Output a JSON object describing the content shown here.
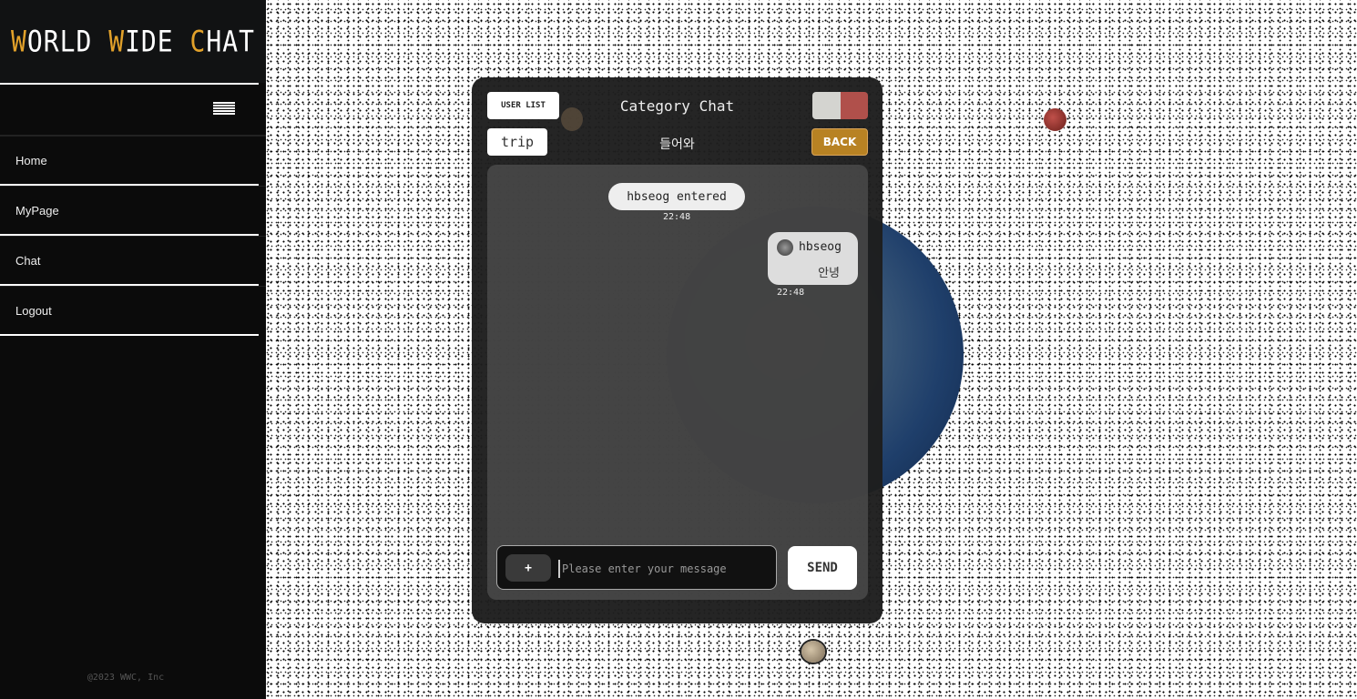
{
  "sidebar": {
    "logo": {
      "w1a": "W",
      "w1b": "ORLD ",
      "w2a": "W",
      "w2b": "IDE ",
      "w3a": "C",
      "w3b": "HAT"
    },
    "nav": [
      "Home",
      "MyPage",
      "Chat",
      "Logout"
    ],
    "copyright": "@2023 WWC, Inc"
  },
  "chat": {
    "user_list": "USER LIST",
    "title": "Category Chat",
    "room_tag": "trip",
    "room_name": "들어와",
    "back": "BACK",
    "toggle_colors": [
      "#d4d4d0",
      "#b0504b"
    ],
    "system_message": {
      "text": "hbseog entered",
      "time": "22:48"
    },
    "messages": [
      {
        "user": "hbseog",
        "text": "안녕",
        "time": "22:48"
      }
    ],
    "input": {
      "plus": "+",
      "placeholder": "Please enter your message",
      "value": ""
    },
    "send": "SEND"
  }
}
